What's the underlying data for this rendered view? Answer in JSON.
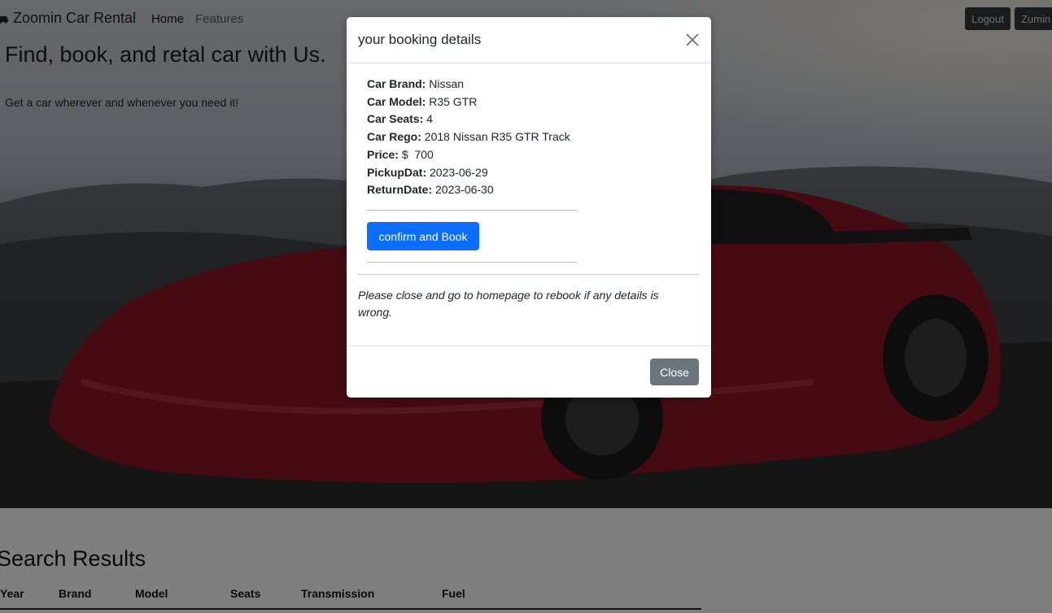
{
  "navbar": {
    "brand": "Zoomin Car Rental",
    "links": [
      "Home",
      "Features"
    ],
    "logout_label": "Logout",
    "user_label": "Zumin"
  },
  "hero": {
    "title": "Find, book, and retal car with Us.",
    "subtitle": "Get a car wherever and whenever you need it!",
    "accent_color": "#9b1d2c"
  },
  "results": {
    "title": "Search Results",
    "columns": [
      "Year",
      "Brand",
      "Model",
      "Seats",
      "Transmission",
      "Fuel"
    ]
  },
  "modal": {
    "title": "your booking details",
    "fields": [
      {
        "label": "Car Brand:",
        "value": "Nissan"
      },
      {
        "label": "Car Model:",
        "value": "R35 GTR"
      },
      {
        "label": "Car Seats:",
        "value": "4"
      },
      {
        "label": "Car Rego:",
        "value": "2018 Nissan R35 GTR Track"
      },
      {
        "label": "Price:",
        "value": "$  700"
      },
      {
        "label": "PickupDat:",
        "value": "2023-06-29"
      },
      {
        "label": "ReturnDate:",
        "value": "2023-06-30"
      }
    ],
    "confirm_label": "confirm and Book",
    "note": "Please close and go to homepage to rebook if any details is wrong.",
    "close_label": "Close",
    "confirm_color": "#0d6efd",
    "close_color": "#6c757d"
  }
}
